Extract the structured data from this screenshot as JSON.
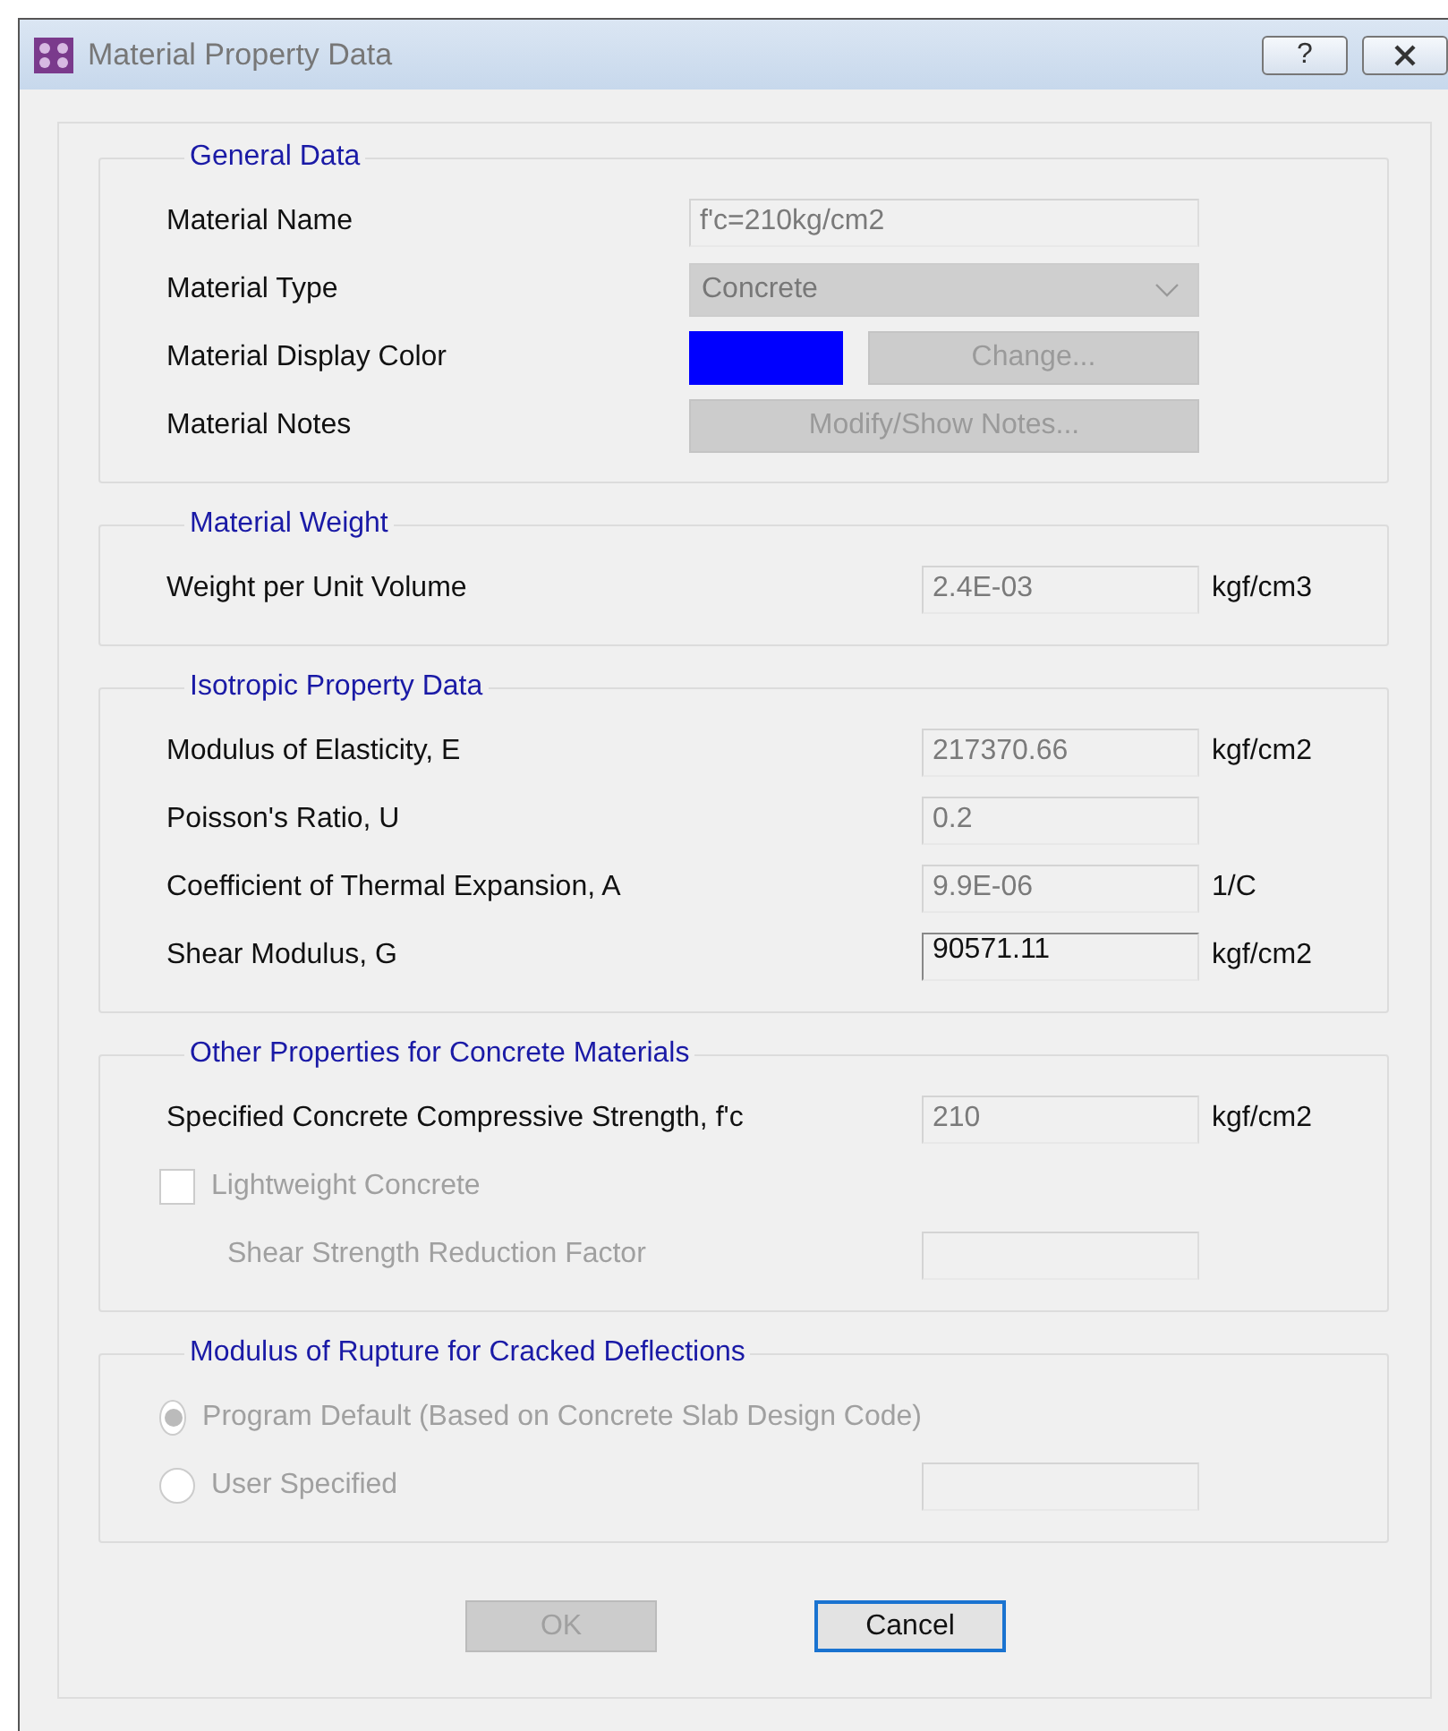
{
  "window": {
    "title": "Material Property Data",
    "help": "?"
  },
  "sections": [
    {
      "title": "General Data",
      "rows": [
        {
          "kind": "text",
          "label": "Material Name",
          "value": "f'c=210kg/cm2",
          "disabled": true
        },
        {
          "kind": "dropdown",
          "label": "Material Type",
          "value": "Concrete",
          "disabled": true
        },
        {
          "kind": "color",
          "label": "Material Display Color",
          "color": "#0000ff",
          "button": "Change...",
          "disabled": true
        },
        {
          "kind": "button",
          "label": "Material Notes",
          "button": "Modify/Show Notes...",
          "disabled": true
        }
      ]
    },
    {
      "title": "Material Weight",
      "rows": [
        {
          "kind": "text",
          "label": "Weight per Unit Volume",
          "value": "2.4E-03",
          "unit": "kgf/cm3",
          "disabled": true
        }
      ]
    },
    {
      "title": "Isotropic Property Data",
      "rows": [
        {
          "kind": "text",
          "label": "Modulus of Elasticity,  E",
          "value": "217370.66",
          "unit": "kgf/cm2",
          "disabled": true
        },
        {
          "kind": "text",
          "label": "Poisson's Ratio,  U",
          "value": "0.2",
          "disabled": true
        },
        {
          "kind": "text",
          "label": "Coefficient of Thermal Expansion,  A",
          "value": "9.9E-06",
          "unit": "1/C",
          "disabled": true
        },
        {
          "kind": "text",
          "label": "Shear Modulus,  G",
          "value": "90571.11",
          "unit": "kgf/cm2",
          "disabled": false
        }
      ]
    },
    {
      "title": "Other Properties for Concrete Materials",
      "rows": [
        {
          "kind": "text",
          "label": "Specified Concrete Compressive Strength, f'c",
          "value": "210",
          "unit": "kgf/cm2",
          "disabled": true
        },
        {
          "kind": "checkbox",
          "label": "Lightweight Concrete",
          "checked": false,
          "disabled": true
        },
        {
          "kind": "subfield",
          "label": "Shear Strength Reduction Factor",
          "disabled": true
        }
      ]
    },
    {
      "title": "Modulus of Rupture for Cracked Deflections",
      "rows": [
        {
          "kind": "radio",
          "label": "Program Default  (Based on Concrete Slab Design Code)",
          "selected": true,
          "disabled": true
        },
        {
          "kind": "radio",
          "label": "User Specified",
          "selected": false,
          "disabled": true,
          "field": true
        }
      ]
    }
  ],
  "buttons": [
    {
      "label": "OK",
      "disabled": true,
      "focused": false
    },
    {
      "label": "Cancel",
      "disabled": false,
      "focused": true
    }
  ]
}
